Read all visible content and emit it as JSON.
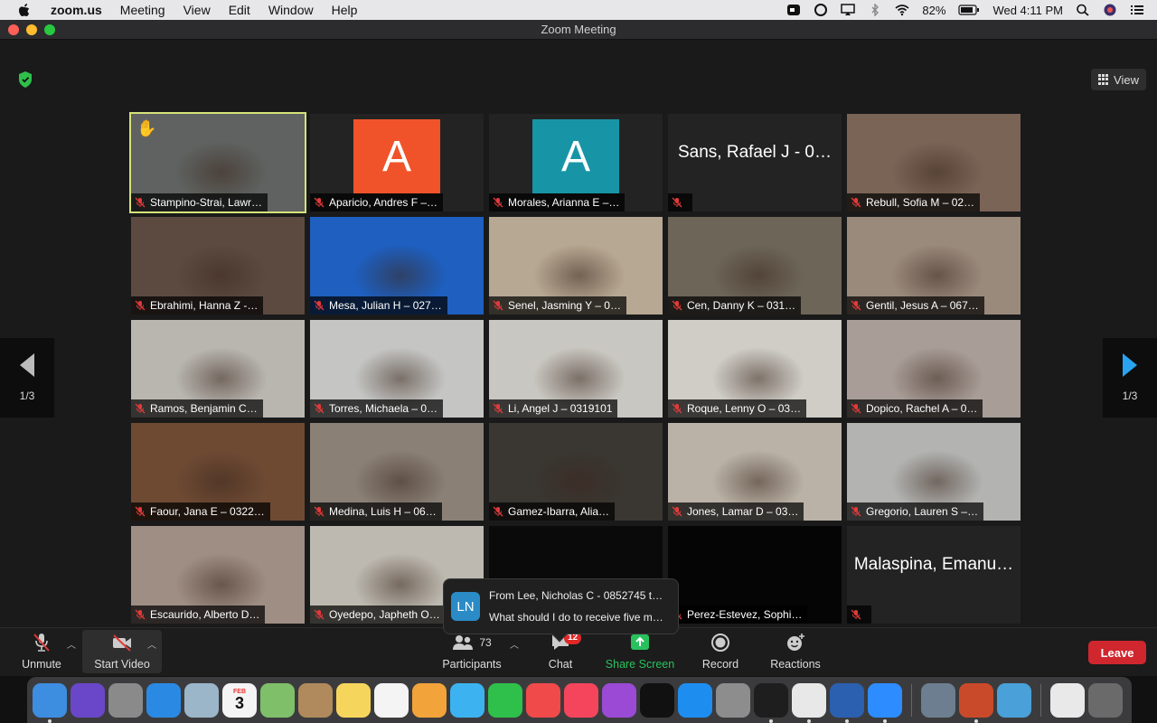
{
  "menubar": {
    "app_name": "zoom.us",
    "menus": [
      "Meeting",
      "View",
      "Edit",
      "Window",
      "Help"
    ],
    "battery": "82%",
    "clock": "Wed 4:11 PM"
  },
  "window": {
    "title": "Zoom Meeting",
    "view_label": "View",
    "page_left": "1/3",
    "page_right": "1/3"
  },
  "participants": [
    {
      "name": "Stampino-Strai, Lawr…",
      "kind": "video",
      "color": "#5f6260",
      "hand": "✋",
      "active": true
    },
    {
      "name": "Aparicio, Andres F –…",
      "kind": "avatar",
      "letter": "A",
      "color": "#f0532a"
    },
    {
      "name": "Morales, Arianna E –…",
      "kind": "avatar",
      "letter": "A",
      "color": "#1795a6"
    },
    {
      "name": "",
      "kind": "name",
      "big": "Sans, Rafael J - 0…"
    },
    {
      "name": "Rebull, Sofia M – 02…",
      "kind": "video",
      "color": "#7a6456"
    },
    {
      "name": "Ebrahimi, Hanna Z -…",
      "kind": "video",
      "color": "#5c4a40"
    },
    {
      "name": "Mesa, Julian H – 027…",
      "kind": "video",
      "color": "#1e5fbf"
    },
    {
      "name": "Senel, Jasming Y – 0…",
      "kind": "video",
      "color": "#b7a893"
    },
    {
      "name": "Cen, Danny K – 031…",
      "kind": "video",
      "color": "#6d6658"
    },
    {
      "name": "Gentil, Jesus A – 067…",
      "kind": "video",
      "color": "#9a8a7c"
    },
    {
      "name": "Ramos, Benjamin C…",
      "kind": "video",
      "color": "#b9b6b0"
    },
    {
      "name": "Torres, Michaela – 0…",
      "kind": "video",
      "color": "#c5c6c4"
    },
    {
      "name": "Li, Angel J – 0319101",
      "kind": "video",
      "color": "#c9c7c1"
    },
    {
      "name": "Roque, Lenny O – 03…",
      "kind": "video",
      "color": "#cfcdc6"
    },
    {
      "name": "Dopico, Rachel A – 0…",
      "kind": "video",
      "color": "#a89d97"
    },
    {
      "name": "Faour, Jana E – 0322…",
      "kind": "video",
      "color": "#6e4a33"
    },
    {
      "name": "Medina, Luis H – 06…",
      "kind": "video",
      "color": "#8a8076"
    },
    {
      "name": "Gamez-Ibarra, Alia…",
      "kind": "video",
      "color": "#3a3631"
    },
    {
      "name": "Jones, Lamar D – 03…",
      "kind": "video",
      "color": "#bab2a6"
    },
    {
      "name": "Gregorio, Lauren S –…",
      "kind": "video",
      "color": "#b3b4b2"
    },
    {
      "name": "Escaurido, Alberto D…",
      "kind": "video",
      "color": "#9f8e84"
    },
    {
      "name": "Oyedepo, Japheth O…",
      "kind": "video",
      "color": "#bdb9b0"
    },
    {
      "name": "",
      "kind": "dark",
      "color": "#0a0a0a"
    },
    {
      "name": "Perez-Estevez, Sophi…",
      "kind": "dark",
      "color": "#050505"
    },
    {
      "name": "",
      "kind": "name",
      "big": "Malaspina, Emanu…"
    }
  ],
  "toast": {
    "initials": "LN",
    "line1": "From Lee, Nicholas C - 0852745 t…",
    "line2": "What should I do to receive five m…"
  },
  "toolbar": {
    "unmute": "Unmute",
    "start_video": "Start Video",
    "participants_label": "Participants",
    "participants_count": "73",
    "chat_label": "Chat",
    "chat_badge": "12",
    "share_label": "Share Screen",
    "record_label": "Record",
    "reactions_label": "Reactions",
    "leave_label": "Leave"
  },
  "dock": {
    "calendar_month": "FEB",
    "calendar_day": "3",
    "apps": [
      {
        "name": "finder",
        "color": "#3d8ee0",
        "run": true
      },
      {
        "name": "siri",
        "color": "#6a47c8",
        "run": false
      },
      {
        "name": "launchpad",
        "color": "#8a8a8a",
        "run": false
      },
      {
        "name": "safari",
        "color": "#2a8ae3",
        "run": false
      },
      {
        "name": "mail-stamp",
        "color": "#9bb6c9",
        "run": false
      },
      {
        "name": "calendar",
        "color": "#f4f4f4",
        "run": false
      },
      {
        "name": "maps",
        "color": "#7fbf6a",
        "run": false
      },
      {
        "name": "contacts",
        "color": "#b08a5c",
        "run": false
      },
      {
        "name": "notes",
        "color": "#f6d55c",
        "run": false
      },
      {
        "name": "reminders",
        "color": "#f4f4f4",
        "run": false
      },
      {
        "name": "photos",
        "color": "#f2a33a",
        "run": false
      },
      {
        "name": "messages",
        "color": "#3cb3f0",
        "run": false
      },
      {
        "name": "facetime",
        "color": "#2fbf4b",
        "run": false
      },
      {
        "name": "news",
        "color": "#f04a4a",
        "run": false
      },
      {
        "name": "music",
        "color": "#f5455c",
        "run": false
      },
      {
        "name": "podcasts",
        "color": "#9b4ad6",
        "run": false
      },
      {
        "name": "tv",
        "color": "#111111",
        "run": false
      },
      {
        "name": "app-store",
        "color": "#1d8ef0",
        "run": false
      },
      {
        "name": "system-preferences",
        "color": "#8d8d8d",
        "run": false
      },
      {
        "name": "spotify",
        "color": "#1e1e1e",
        "run": true
      },
      {
        "name": "chrome",
        "color": "#e8e8e8",
        "run": true
      },
      {
        "name": "word",
        "color": "#2b5fb0",
        "run": true
      },
      {
        "name": "zoom",
        "color": "#2d8cff",
        "run": true
      },
      {
        "name": "preview",
        "color": "#6d7e90",
        "run": false
      },
      {
        "name": "powerpoint",
        "color": "#c94a2a",
        "run": true
      },
      {
        "name": "network-utility",
        "color": "#4aa0d8",
        "run": false
      },
      {
        "name": "document",
        "color": "#e9e9e9",
        "run": false
      },
      {
        "name": "trash",
        "color": "#6a6a6a",
        "run": false
      }
    ]
  }
}
